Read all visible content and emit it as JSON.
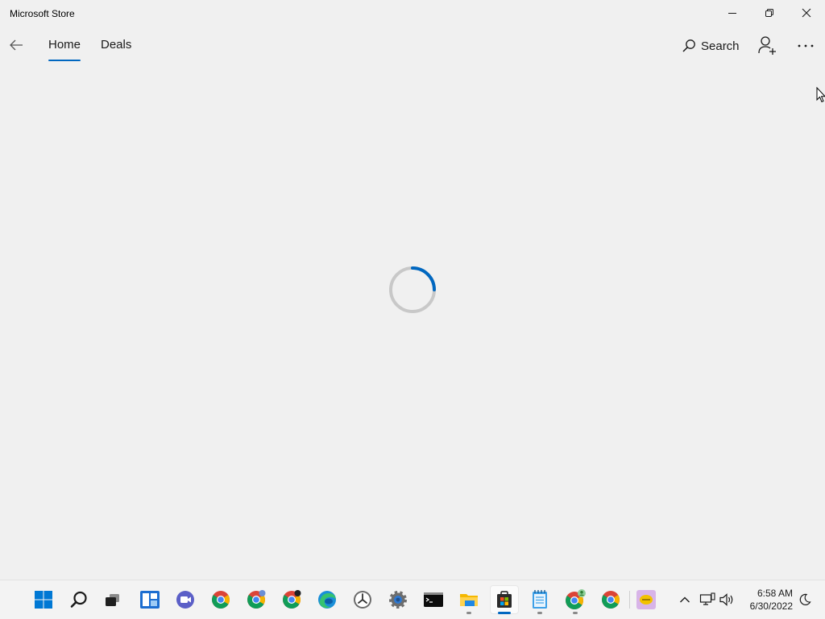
{
  "window": {
    "title": "Microsoft Store",
    "controls": [
      "minimize-icon",
      "restore-icon",
      "close-icon"
    ]
  },
  "nav": {
    "tabs": [
      {
        "label": "Home",
        "active": true
      },
      {
        "label": "Deals",
        "active": false
      }
    ],
    "search_label": "Search"
  },
  "colors": {
    "accent": "#0067c0",
    "background": "#f0f0f0",
    "taskbar": "#f3f3f3"
  },
  "taskbar": {
    "apps": [
      {
        "name": "start",
        "icon": "windows-logo-icon"
      },
      {
        "name": "search",
        "icon": "search-icon"
      },
      {
        "name": "task-view",
        "icon": "task-view-icon"
      },
      {
        "name": "widgets",
        "icon": "widgets-icon"
      },
      {
        "name": "teams-chat",
        "icon": "chat-icon"
      },
      {
        "name": "chrome",
        "icon": "chrome-icon"
      },
      {
        "name": "chrome-profile-2",
        "icon": "chrome-icon"
      },
      {
        "name": "chrome-profile-3",
        "icon": "chrome-icon"
      },
      {
        "name": "edge",
        "icon": "edge-icon"
      },
      {
        "name": "clock-app",
        "icon": "clock-icon"
      },
      {
        "name": "settings",
        "icon": "gear-icon"
      },
      {
        "name": "terminal",
        "icon": "terminal-icon"
      },
      {
        "name": "file-explorer",
        "icon": "folder-icon",
        "running": true
      },
      {
        "name": "microsoft-store",
        "icon": "store-bag-icon",
        "running": true,
        "active": true
      },
      {
        "name": "notepad",
        "icon": "notepad-icon",
        "running": true
      },
      {
        "name": "chrome-profile-4",
        "icon": "chrome-icon",
        "running": true
      },
      {
        "name": "chrome-profile-5",
        "icon": "chrome-icon"
      },
      {
        "name": "app-yellow",
        "icon": "app-icon"
      }
    ],
    "tray": {
      "icons": [
        "chevron-up-icon",
        "network-icon",
        "volume-icon"
      ],
      "time": "6:58 AM",
      "date": "6/30/2022"
    }
  }
}
